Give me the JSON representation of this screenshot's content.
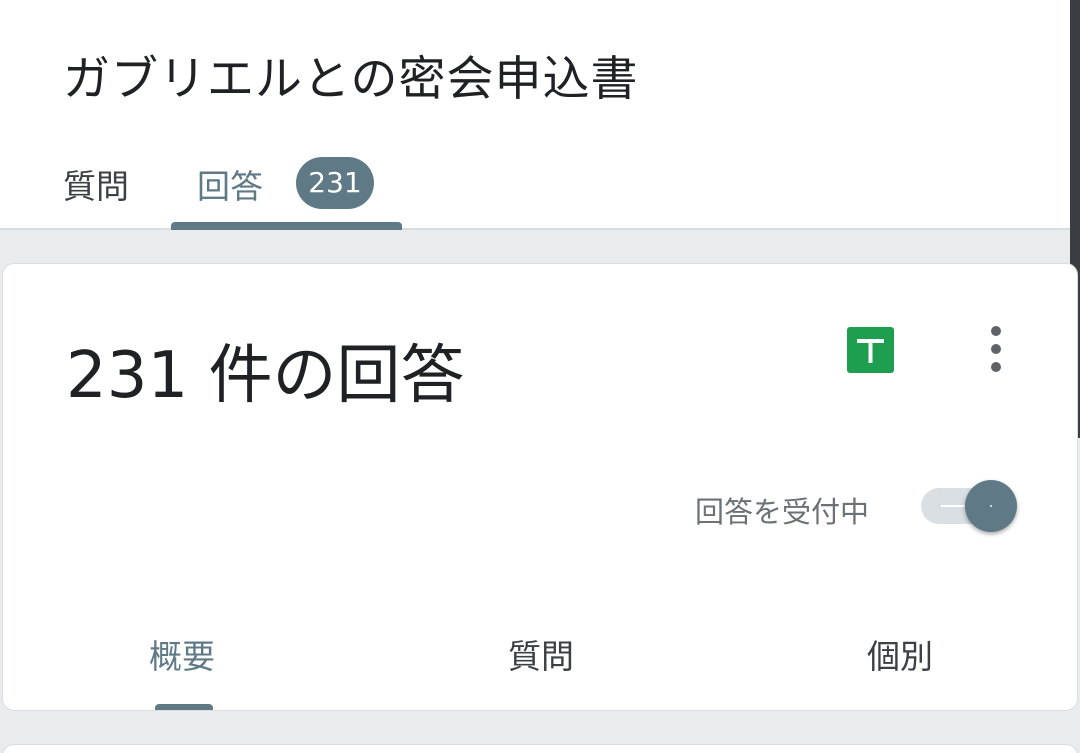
{
  "form": {
    "title": "ガブリエルとの密会申込書"
  },
  "tabs": {
    "questions_label": "質問",
    "responses_label": "回答",
    "responses_count": "231",
    "active": "responses"
  },
  "card": {
    "title": "231 件の回答",
    "accepting_label": "回答を受付中",
    "accepting_on": true,
    "icons": [
      "sheets-icon",
      "more-vert-icon"
    ]
  },
  "subtabs": {
    "summary_label": "概要",
    "question_label": "質問",
    "individual_label": "個別",
    "active": "summary"
  },
  "colors": {
    "accent": "#5f7a86",
    "sheets_green": "#1e9e4f",
    "background": "#e8ecef"
  }
}
